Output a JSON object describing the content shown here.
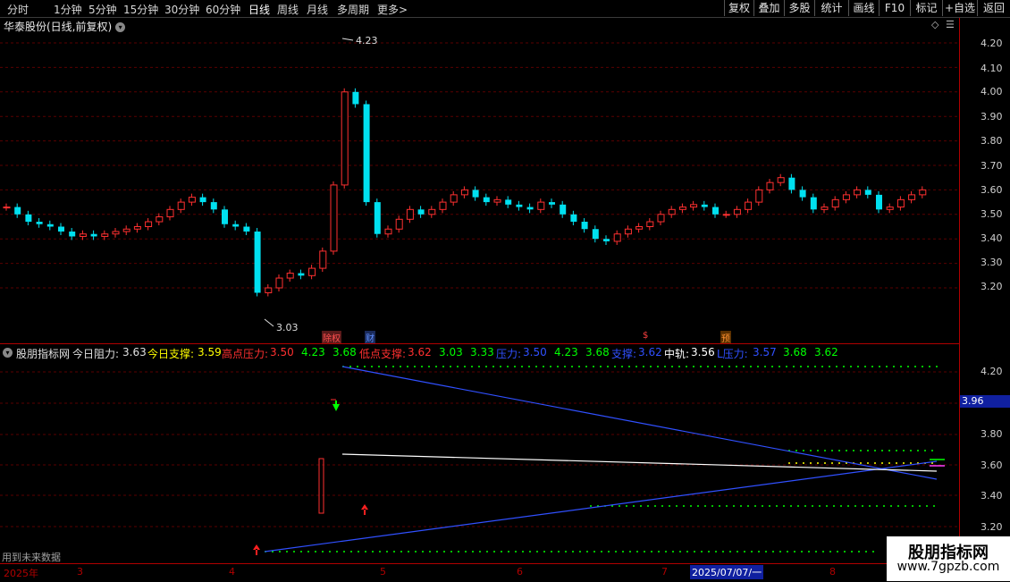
{
  "toolbar": {
    "periods": [
      "分时",
      "1分钟",
      "5分钟",
      "15分钟",
      "30分钟",
      "60分钟",
      "日线",
      "周线",
      "月线",
      "多周期",
      "更多"
    ],
    "more_arrow": ">",
    "right_buttons": [
      "复权",
      "叠加",
      "多股",
      "统计",
      "画线",
      "F10",
      "标记",
      "+自选",
      "返回"
    ]
  },
  "stock": {
    "title": "华泰股份(日线,前复权)",
    "high_label": "4.23",
    "low_label": "3.03"
  },
  "price_axis": [
    "4.20",
    "4.10",
    "4.00",
    "3.90",
    "3.80",
    "3.70",
    "3.60",
    "3.50",
    "3.40",
    "3.30",
    "3.20"
  ],
  "event_markers": [
    {
      "text": "除权",
      "color": "#ff4040"
    },
    {
      "text": "财",
      "color": "#4080ff"
    },
    {
      "text": "$",
      "color": "#ff4040"
    },
    {
      "text": "预",
      "color": "#ff8000"
    }
  ],
  "indicator": {
    "name": "股朋指标网",
    "items": [
      {
        "label": "今日阻力:",
        "value": "3.63",
        "color": "#e0e0e0"
      },
      {
        "label": "今日支撑:",
        "value": "3.59",
        "color": "#ffff00"
      },
      {
        "label": "高点压力:",
        "value": "3.50",
        "color": "#ff3030"
      },
      {
        "label": "4.23",
        "value": "3.68",
        "color": "#00ff00"
      },
      {
        "label": "低点支撑:",
        "value": "3.62",
        "color": "#ff3030"
      },
      {
        "label": "3.03",
        "value": "3.33",
        "color": "#00ff00"
      },
      {
        "label": "压力:",
        "value": "3.50",
        "color": "#3050ff"
      },
      {
        "label": "4.23",
        "value": "3.68",
        "color": "#00ff00"
      },
      {
        "label": "支撑:",
        "value": "3.62",
        "color": "#3050ff"
      },
      {
        "label": "中轨:",
        "value": "3.56",
        "color": "#ffffff"
      },
      {
        "label": "L压力:",
        "value": "3.57",
        "color": "#3050ff"
      },
      {
        "label": "3.68",
        "value": "3.62",
        "color": "#00ff00"
      }
    ],
    "axis": [
      "4.20",
      "3.80",
      "3.60",
      "3.40",
      "3.20"
    ],
    "current_value": "3.96",
    "footer_note": "用到未来数据"
  },
  "x_axis": {
    "year": "2025年",
    "months": [
      "3",
      "4",
      "5",
      "6",
      "7",
      "8"
    ],
    "cursor_date": "2025/07/07/一"
  },
  "watermark": {
    "line1": "股朋指标网",
    "line2": "www.7gpzb.com"
  },
  "colors": {
    "up": "#ff3030",
    "down": "#00e0f0",
    "grid": "#5a0000",
    "axis": "#b00000"
  }
}
